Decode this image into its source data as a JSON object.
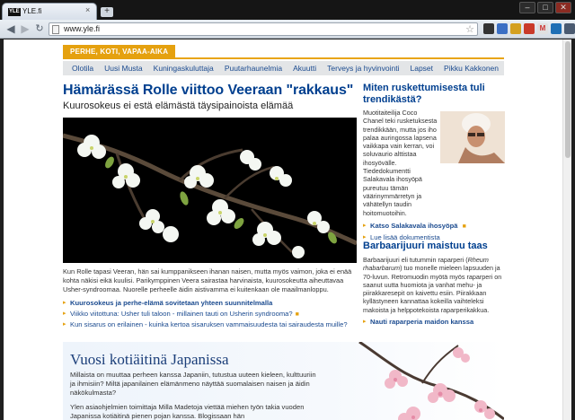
{
  "browser": {
    "tab_title": "YLE.fi",
    "tab_favicon_text": "YLE",
    "tab_close": "×",
    "new_tab": "+",
    "url": "www.yle.fi",
    "win_minimize": "–",
    "win_maximize": "□",
    "win_close": "✕"
  },
  "page": {
    "section_label": "PERHE, KOTI, VAPAA-AIKA",
    "subnav": [
      "Olotila",
      "Uusi Musta",
      "Kuningaskuluttaja",
      "Puutarhaunelmia",
      "Akuutti",
      "Terveys ja hyvinvointi",
      "Lapset",
      "Pikku Kakkonen"
    ],
    "main": {
      "headline": "Hämärässä Rolle viittoo Veeraan \"rakkaus\"",
      "subheadline": "Kuurosokeus ei estä elämästä täysipainoista elämää",
      "body": "Kun Rolle tapasi Veeran, hän sai kumppanikseen ihanan naisen, mutta myös vaimon, joka ei enää kohta näkisi eikä kuulisi. Parikymppinen Veera sairastaa harvinaista, kuurosokeutta aiheuttavaa Usher-syndroomaa. Nuorelle perheelle äidin aistivamma ei kuitenkaan ole maailmanloppu.",
      "related": [
        {
          "text": "Kuurosokeus ja perhe-elämä sovitetaan yhteen suunnitelmalla",
          "bold": true,
          "cam": false
        },
        {
          "text": "Viikko viitottuna: Usher tuli taloon - millainen tauti on Usherin syndrooma?",
          "bold": false,
          "cam": true
        },
        {
          "text": "Kun sisarus on erilainen - kuinka kertoa sisaruksen vammaisuudesta tai sairaudesta muille?",
          "bold": false,
          "cam": false
        }
      ]
    },
    "sidebar1": {
      "headline": "Miten ruskettumisesta tuli trendikästä?",
      "text": "Muotitaiteilija Coco Chanel teki rusketuksesta trendikkään, mutta jos iho palaa auringossa lapsena vaikkapa vain kerran, voi soluvaurio alttistaa ihosyövälle. Tiededokumentti Salakavala ihosyöpä pureutuu tämän väärinymmärretyn ja vähätellyn taudin hoitomuotoihin.",
      "link1": "Katso Salakavala ihosyöpä",
      "link2": "Lue lisää dokumentista"
    },
    "sidebar2": {
      "headline": "Barbaarijuuri maistuu taas",
      "text_1": "Barbaarijuuri eli tutummin raparperi (",
      "text_italic": "Rheum rhabarbarum",
      "text_2": ") tuo monelle mieleen lapsuuden ja 70-luvun. Retromuodin myötä myös raparperi on saanut uutta huomiota ja vanhat mehu- ja piirakkaresepit on kaivettu esiin. Piirakkaan kyllästyneen kannattaa kokeilla vaihteleksi makoista ja helppotekoista raparperikakkua.",
      "link": "Nauti raparperia maidon kanssa"
    },
    "promo": {
      "title": "Vuosi kotiäitinä Japanissa",
      "text": "Millaista on muuttaa perheen kanssa Japaniin, tutustua uuteen kieleen, kulttuuriin ja ihmisiin? Miltä japanilainen elämänmeno näyttää suomalaisen naisen ja äidin näkökulmasta?",
      "text2": "Ylen asiaohjelmien toimittaja Milla Madetoja viettää miehen työn takia vuoden Japanissa kotiäitinä pienen pojan kanssa. Blogissaan hän"
    }
  },
  "icons": {
    "back": "back-arrow-icon",
    "forward": "forward-arrow-icon",
    "reload": "reload-icon",
    "star": "bookmark-star-icon",
    "camera": "video-camera-icon"
  },
  "colors": {
    "accent_orange": "#e5a10f",
    "link_blue": "#1a4a8f",
    "headline_blue": "#003f8f"
  }
}
